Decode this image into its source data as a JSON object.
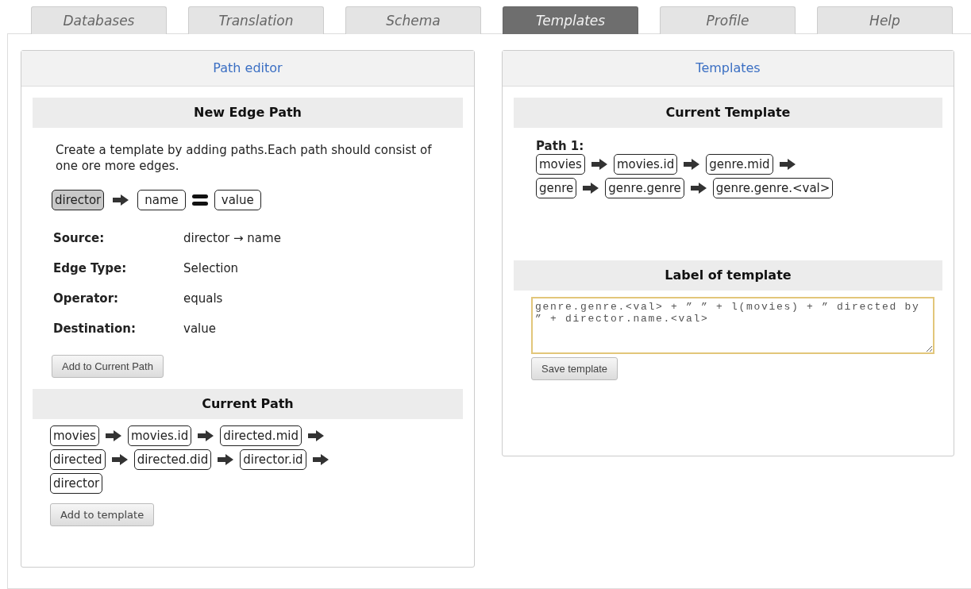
{
  "tabs": [
    {
      "label": "Databases",
      "selected": false
    },
    {
      "label": "Translation",
      "selected": false
    },
    {
      "label": "Schema",
      "selected": false
    },
    {
      "label": "Templates",
      "selected": true
    },
    {
      "label": "Profile",
      "selected": false
    },
    {
      "label": "Help",
      "selected": false
    }
  ],
  "path_editor": {
    "title": "Path editor",
    "new_edge_path": {
      "heading": "New Edge Path",
      "description": "Create a template by adding paths.Each path should consist of one ore more edges.",
      "edge": [
        {
          "kind": "node",
          "label": "director",
          "selected": true
        },
        {
          "kind": "arrow"
        },
        {
          "kind": "node",
          "label": "name",
          "selected": false
        },
        {
          "kind": "equals"
        },
        {
          "kind": "node",
          "label": "value",
          "selected": false
        }
      ],
      "properties": [
        {
          "label": "Source:",
          "value": "director → name"
        },
        {
          "label": "Edge Type:",
          "value": "Selection"
        },
        {
          "label": "Operator:",
          "value": "equals"
        },
        {
          "label": "Destination:",
          "value": "value"
        }
      ],
      "button": "Add to Current Path"
    },
    "current_path": {
      "heading": "Current Path",
      "rows": [
        [
          "movies",
          "movies.id",
          "directed.mid"
        ],
        [
          "directed",
          "directed.did",
          "director.id"
        ],
        [
          "director"
        ]
      ],
      "button": "Add to template"
    }
  },
  "templates": {
    "title": "Templates",
    "current_template": {
      "heading": "Current Template",
      "paths": [
        {
          "label": "Path 1:",
          "rows": [
            [
              "movies",
              "movies.id",
              "genre.mid"
            ],
            [
              "genre",
              "genre.genre",
              "genre.genre.<val>"
            ]
          ]
        }
      ]
    },
    "label_of_template": {
      "heading": "Label of template",
      "value": "genre.genre.<val> + ” ” + l(movies) + ” directed by ” + director.name.<val>",
      "button": "Save template"
    }
  }
}
